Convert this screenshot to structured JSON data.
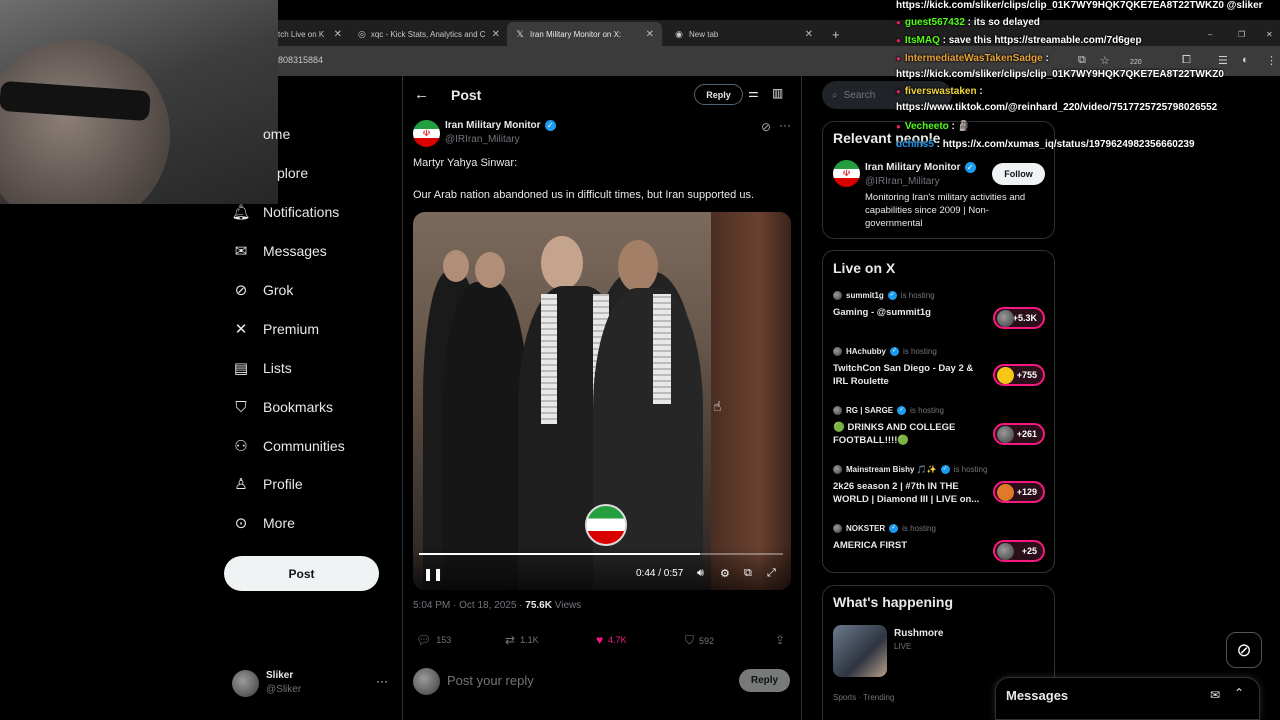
{
  "browser": {
    "tabs": [
      {
        "label": "tch Live on K",
        "icon": "kick-icon"
      },
      {
        "label": "xqc - Kick Stats, Analytics and C",
        "icon": "globe-icon"
      },
      {
        "label": "Iran Military Monitor on X:",
        "icon": "x-logo-icon",
        "active": true
      },
      {
        "label": "New tab",
        "icon": "chrome-icon"
      }
    ],
    "new_tab": "+",
    "address": "808315884",
    "window_controls": [
      "–",
      "❐",
      "✕"
    ],
    "ext_badge": "220"
  },
  "nav": {
    "items": [
      {
        "label": "ome",
        "icon": "home-icon"
      },
      {
        "label": "plore",
        "icon": "explore-icon"
      },
      {
        "label": "Notifications",
        "icon": "bell-icon"
      },
      {
        "label": "Messages",
        "icon": "envelope-icon"
      },
      {
        "label": "Grok",
        "icon": "grok-icon"
      },
      {
        "label": "Premium",
        "icon": "x-logo-icon"
      },
      {
        "label": "Lists",
        "icon": "list-icon"
      },
      {
        "label": "Bookmarks",
        "icon": "bookmark-icon"
      },
      {
        "label": "Communities",
        "icon": "communities-icon"
      },
      {
        "label": "Profile",
        "icon": "person-icon"
      },
      {
        "label": "More",
        "icon": "more-circle-icon"
      }
    ],
    "post_button": "Post",
    "user": {
      "name": "Sliker",
      "handle": "@Sliker",
      "more": "···"
    }
  },
  "main": {
    "header": {
      "back": "←",
      "title": "Post",
      "reply_button": "Reply"
    },
    "author": {
      "name": "Iran Military Monitor",
      "handle": "@IRIran_Military"
    },
    "text_line1": "Martyr Yahya Sinwar:",
    "text_line2": "Our Arab nation abandoned us in difficult times, but Iran supported us.",
    "video": {
      "time": "0:44 / 0:57",
      "progress": 0.772
    },
    "meta": {
      "date": "5:04 PM · Oct 18, 2025 · ",
      "views": "75.6K",
      "views_label": " Views"
    },
    "actions": {
      "replies": "153",
      "reposts": "1.1K",
      "likes": "4.7K",
      "bookmarks": "592"
    },
    "reply_box": {
      "placeholder": "Post your reply",
      "button": "Reply"
    }
  },
  "right": {
    "search_placeholder": "Search",
    "relevant": {
      "title": "Relevant people",
      "name": "Iran Military Monitor",
      "handle": "@IRIran_Military",
      "follow": "Follow",
      "bio": "Monitoring Iran's military activities and capabilities since 2009 | Non-governmental"
    },
    "live": {
      "title": "Live on X",
      "hosting_label": "is hosting",
      "items": [
        {
          "host": "summit1g",
          "title": "Gaming - @summit1g",
          "count": "+5.3K"
        },
        {
          "host": "HAchubby",
          "title": "TwitchCon San Diego - Day 2 & IRL Roulette",
          "count": "+755"
        },
        {
          "host": "RG | SARGE",
          "title": "🟢 DRINKS AND COLLEGE FOOTBALL!!!!🟢",
          "count": "+261"
        },
        {
          "host": "Mainstream Bishy 🎵✨",
          "title": "2k26 season 2 | #7th IN THE WORLD | Diamond III | LIVE on...",
          "count": "+129"
        },
        {
          "host": "NOKSTER",
          "title": "AMERICA FIRST",
          "count": "+25"
        }
      ]
    },
    "happening": {
      "title": "What's happening",
      "item_title": "Rushmore",
      "item_sub": "LIVE",
      "footer": "Sports · Trending"
    }
  },
  "chat": [
    {
      "user": "",
      "text": "https://kick.com/sliker/clips/clip_01K7WY9HQK7QKE7EA8T22TWKZ0 @sliker"
    },
    {
      "user": "guest567432",
      "sep": " : ",
      "text": "its so delayed",
      "green": true
    },
    {
      "user": "ItsMAQ",
      "sep": " : ",
      "text": "save this https://streamable.com/7d6gep",
      "green": true
    },
    {
      "user": "IntermediateWasTakenSadge",
      "sep": " :",
      "text": ""
    },
    {
      "user": "",
      "text": "https://kick.com/sliker/clips/clip_01K7WY9HQK7QKE7EA8T22TWKZ0"
    },
    {
      "user": "fiverswastaken",
      "sep": " :",
      "text": ""
    },
    {
      "user": "",
      "text": "https://www.tiktok.com/@reinhard_220/video/7517725725798026552"
    },
    {
      "user": "Vecheeto",
      "sep": " : ",
      "text": "🗿",
      "green": true
    },
    {
      "user": "uchins5",
      "sep": " : ",
      "text": "https://x.com/xumas_iq/status/1979624982356660239",
      "blue": true
    }
  ],
  "messages_bar": {
    "title": "Messages"
  }
}
